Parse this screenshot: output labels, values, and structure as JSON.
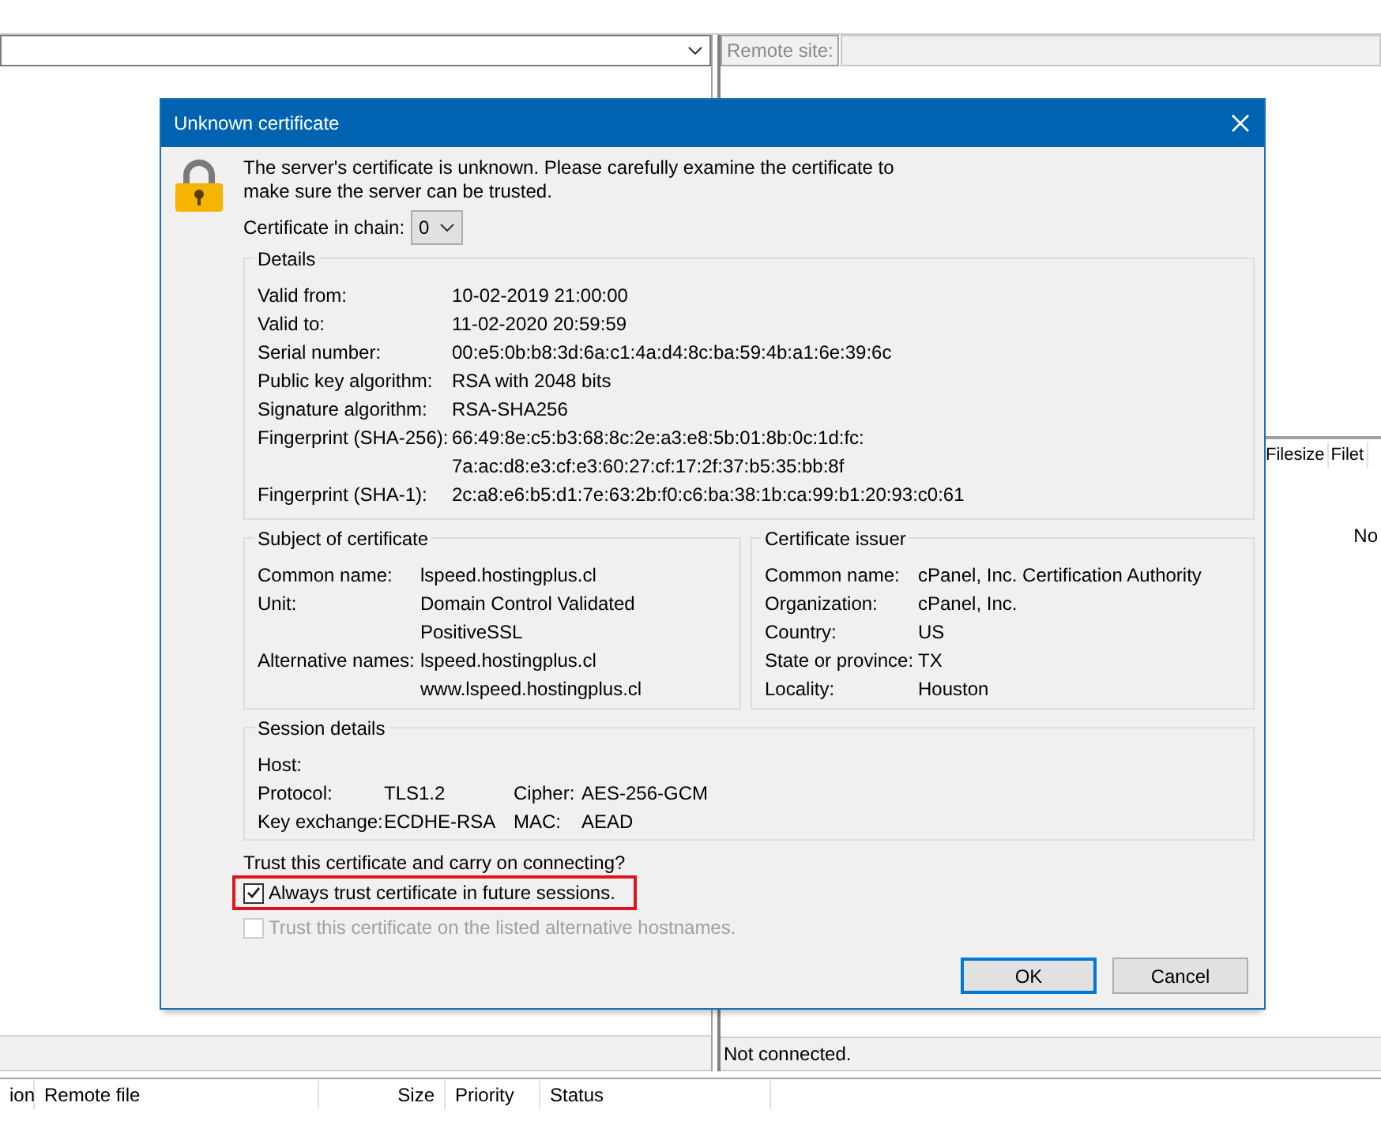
{
  "remote_site": {
    "label": "Remote site:"
  },
  "remote_files": {
    "columns": [
      "Filesize",
      "Filet"
    ],
    "message": "No"
  },
  "status": {
    "remote": "Not connected."
  },
  "queue": {
    "columns": [
      "ion",
      "Remote file",
      "Size",
      "Priority",
      "Status"
    ]
  },
  "dialog": {
    "title": "Unknown certificate",
    "message": "The server's certificate is unknown. Please carefully examine the certificate to make sure the server can be trusted.",
    "chain": {
      "label": "Certificate in chain:",
      "value": "0"
    },
    "details": {
      "title": "Details",
      "rows": [
        {
          "label": "Valid from:",
          "values": [
            "10-02-2019 21:00:00"
          ]
        },
        {
          "label": "Valid to:",
          "values": [
            "11-02-2020 20:59:59"
          ]
        },
        {
          "label": "Serial number:",
          "values": [
            "00:e5:0b:b8:3d:6a:c1:4a:d4:8c:ba:59:4b:a1:6e:39:6c"
          ]
        },
        {
          "label": "Public key algorithm:",
          "values": [
            "RSA with 2048 bits"
          ]
        },
        {
          "label": "Signature algorithm:",
          "values": [
            "RSA-SHA256"
          ]
        },
        {
          "label": "Fingerprint (SHA-256):",
          "values": [
            "66:49:8e:c5:b3:68:8c:2e:a3:e8:5b:01:8b:0c:1d:fc:",
            "7a:ac:d8:e3:cf:e3:60:27:cf:17:2f:37:b5:35:bb:8f"
          ]
        },
        {
          "label": "Fingerprint (SHA-1):",
          "values": [
            "2c:a8:e6:b5:d1:7e:63:2b:f0:c6:ba:38:1b:ca:99:b1:20:93:c0:61"
          ]
        }
      ]
    },
    "subject": {
      "title": "Subject of certificate",
      "rows": [
        {
          "label": "Common name:",
          "values": [
            "lspeed.hostingplus.cl"
          ]
        },
        {
          "label": "Unit:",
          "values": [
            "Domain Control Validated",
            "PositiveSSL"
          ]
        },
        {
          "label": "Alternative names:",
          "values": [
            "lspeed.hostingplus.cl",
            "www.lspeed.hostingplus.cl"
          ]
        }
      ]
    },
    "issuer": {
      "title": "Certificate issuer",
      "rows": [
        {
          "label": "Common name:",
          "values": [
            "cPanel, Inc. Certification Authority"
          ]
        },
        {
          "label": "Organization:",
          "values": [
            "cPanel, Inc."
          ]
        },
        {
          "label": "Country:",
          "values": [
            "US"
          ]
        },
        {
          "label": "State or province:",
          "values": [
            "TX"
          ]
        },
        {
          "label": "Locality:",
          "values": [
            "Houston"
          ]
        }
      ]
    },
    "session": {
      "title": "Session details",
      "lines": [
        [
          {
            "label": "Host:"
          }
        ],
        [
          {
            "label": "Protocol:",
            "value": "TLS1.2"
          },
          {
            "label": "Cipher:",
            "value": "AES-256-GCM"
          }
        ],
        [
          {
            "label": "Key exchange:",
            "value": "ECDHE-RSA"
          },
          {
            "label": "MAC:",
            "value": "AEAD"
          }
        ]
      ]
    },
    "question": "Trust this certificate and carry on connecting?",
    "options": [
      {
        "label": "Always trust certificate in future sessions.",
        "checked": true,
        "disabled": false,
        "highlighted": true
      },
      {
        "label": "Trust this certificate on the listed alternative hostnames.",
        "checked": false,
        "disabled": true,
        "highlighted": false
      }
    ],
    "buttons": [
      {
        "label": "OK",
        "default": true
      },
      {
        "label": "Cancel",
        "default": false
      }
    ]
  }
}
